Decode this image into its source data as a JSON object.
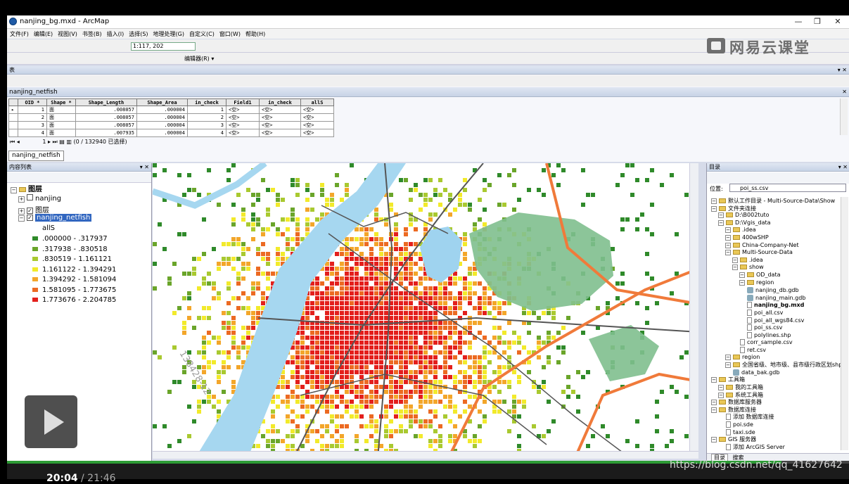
{
  "window": {
    "title": "nanjing_bg.mxd - ArcMap",
    "minimize": "—",
    "restore": "❐",
    "close": "✕"
  },
  "menu": [
    "文件(F)",
    "编辑(E)",
    "视图(V)",
    "书签(B)",
    "插入(I)",
    "选择(S)",
    "地理处理(G)",
    "自定义(C)",
    "窗口(W)",
    "帮助(H)"
  ],
  "toolbar": {
    "scale": "1:117, 202",
    "editor": "编辑器(R) ▾"
  },
  "brand": "网易云课堂",
  "table_window": {
    "header": "表",
    "name": "nanjing_netfish",
    "columns": [
      "OID *",
      "Shape *",
      "Shape_Length",
      "Shape_Area",
      "in_check",
      "Field1",
      "in_check",
      "allS"
    ],
    "rows": [
      [
        "1",
        "面",
        ".008057",
        ".000004",
        "1",
        "<空>",
        "<空>",
        "<空>"
      ],
      [
        "2",
        "面",
        ".008057",
        ".000004",
        "2",
        "<空>",
        "<空>",
        "<空>"
      ],
      [
        "3",
        "面",
        ".008057",
        ".000004",
        "3",
        "<空>",
        "<空>",
        "<空>"
      ],
      [
        "4",
        "面",
        ".007935",
        ".000004",
        "4",
        "<空>",
        "<空>",
        "<空>"
      ]
    ],
    "nav_record": "1",
    "selection_status": "(0 / 132940 已选择)",
    "tab_label": "nanjing_netfish"
  },
  "toc": {
    "header": "内容列表",
    "root": "图层",
    "layers": [
      "nanjing",
      "图层",
      "nanjing_netfish"
    ],
    "field": "allS",
    "legend": [
      {
        "label": ".000000 - .317937",
        "color": "#2f8a2a"
      },
      {
        "label": ".317938 - .830518",
        "color": "#6aa52a"
      },
      {
        "label": ".830519 - 1.161121",
        "color": "#a9c930"
      },
      {
        "label": "1.161122 - 1.394291",
        "color": "#f2ea2b"
      },
      {
        "label": "1.394292 - 1.581094",
        "color": "#f3a62a"
      },
      {
        "label": "1.581095 - 1.773675",
        "color": "#ec6a22"
      },
      {
        "label": "1.773676 - 2.204785",
        "color": "#e31f1c"
      }
    ]
  },
  "map": {
    "annotation": "138428-12"
  },
  "catalog": {
    "header": "目录",
    "location_label": "位置:",
    "location_value": "poi_ss.csv",
    "items": [
      {
        "text": "默认工作目录 - Multi-Source-Data\\Show",
        "level": 0,
        "kind": "folder"
      },
      {
        "text": "文件夹连接",
        "level": 0,
        "kind": "folder"
      },
      {
        "text": "D:\\B002tuto",
        "level": 1,
        "kind": "folder"
      },
      {
        "text": "D:\\Vgis_data",
        "level": 1,
        "kind": "folder"
      },
      {
        "text": ".idea",
        "level": 2,
        "kind": "folder"
      },
      {
        "text": "400wSHP",
        "level": 2,
        "kind": "folder"
      },
      {
        "text": "China-Company-Net",
        "level": 2,
        "kind": "folder"
      },
      {
        "text": "Multi-Source-Data",
        "level": 2,
        "kind": "folder"
      },
      {
        "text": ".idea",
        "level": 3,
        "kind": "folder"
      },
      {
        "text": "show",
        "level": 3,
        "kind": "folder"
      },
      {
        "text": "OD_data",
        "level": 4,
        "kind": "folder"
      },
      {
        "text": "region",
        "level": 4,
        "kind": "folder"
      },
      {
        "text": "nanjing_db.gdb",
        "level": 4,
        "kind": "db"
      },
      {
        "text": "nanjing_main.gdb",
        "level": 4,
        "kind": "db"
      },
      {
        "text": "nanjing_bg.mxd",
        "level": 4,
        "kind": "file",
        "bold": true
      },
      {
        "text": "poi_all.csv",
        "level": 4,
        "kind": "file"
      },
      {
        "text": "poi_all_wgs84.csv",
        "level": 4,
        "kind": "file"
      },
      {
        "text": "poi_ss.csv",
        "level": 4,
        "kind": "file"
      },
      {
        "text": "polylines.shp",
        "level": 4,
        "kind": "file"
      },
      {
        "text": "corr_sample.csv",
        "level": 3,
        "kind": "file"
      },
      {
        "text": "ret.csv",
        "level": 3,
        "kind": "file"
      },
      {
        "text": "region",
        "level": 2,
        "kind": "folder"
      },
      {
        "text": "全国省级、地市级、县市级行政区划shp",
        "level": 2,
        "kind": "folder"
      },
      {
        "text": "data_bak.gdb",
        "level": 2,
        "kind": "db"
      },
      {
        "text": "工具箱",
        "level": 0,
        "kind": "folder"
      },
      {
        "text": "我的工具箱",
        "level": 1,
        "kind": "folder"
      },
      {
        "text": "系统工具箱",
        "level": 1,
        "kind": "folder"
      },
      {
        "text": "数据库服务器",
        "level": 0,
        "kind": "folder"
      },
      {
        "text": "数据库连接",
        "level": 0,
        "kind": "folder"
      },
      {
        "text": "添加 数据库连接",
        "level": 1,
        "kind": "file"
      },
      {
        "text": "poi.sde",
        "level": 1,
        "kind": "file"
      },
      {
        "text": "taxi.sde",
        "level": 1,
        "kind": "file"
      },
      {
        "text": "GIS 服务器",
        "level": 0,
        "kind": "folder"
      },
      {
        "text": "添加 ArcGIS Server",
        "level": 1,
        "kind": "file"
      }
    ],
    "tabs": [
      "目录",
      "搜索"
    ]
  },
  "video": {
    "time": "20:04",
    "total": "/ 21:46",
    "progress": 0.92,
    "watermark": "https://blog.csdn.net/qq_41627642"
  }
}
